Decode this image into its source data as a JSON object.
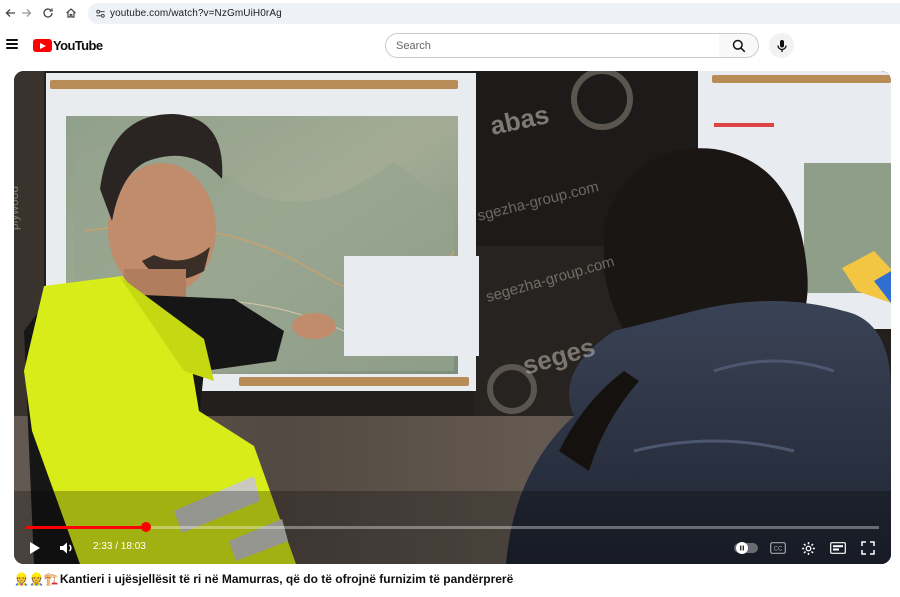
{
  "browser": {
    "url": "youtube.com/watch?v=NzGmUiH0rAg"
  },
  "header": {
    "logo_text": "YouTube",
    "search_placeholder": "Search"
  },
  "player": {
    "current_time": "2:33",
    "duration": "18:03",
    "time_display": "2:33 / 18:03",
    "progress": 0.141,
    "accent_color": "#ff0000"
  },
  "scene_text": {
    "banner_1": "abas",
    "banner_2": "sgezha-group.com",
    "banner_3": "segezha-group.com",
    "banner_4": "seges",
    "side_label": "plywood"
  },
  "video": {
    "title": "Kantieri i ujësjellësit të ri në Mamurras, që do të ofrojnë furnizim të pandërprerë",
    "title_emojis": "👷👷🏗️"
  }
}
